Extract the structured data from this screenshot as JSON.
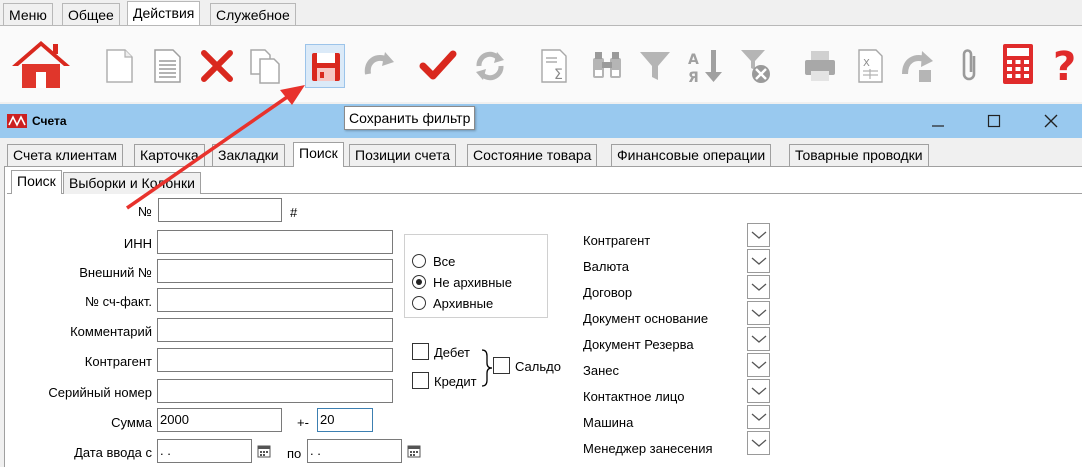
{
  "menu_tabs": [
    "Меню",
    "Общее",
    "Действия",
    "Служебное"
  ],
  "active_menu_tab": "Действия",
  "toolbar": {
    "buttons": [
      "home-icon",
      "new-document-icon",
      "document-icon",
      "delete-icon",
      "copy-icon",
      "save-filter-icon",
      "undo-icon",
      "confirm-icon",
      "refresh-icon",
      "sum-icon",
      "binoculars-icon",
      "filter-icon",
      "sort-icon",
      "clear-filter-icon",
      "print-icon",
      "excel-icon",
      "export-icon",
      "attach-icon",
      "calculator-icon",
      "help-icon"
    ],
    "tooltip": "Сохранить фильтр"
  },
  "window": {
    "title": "Счета"
  },
  "tabs": [
    "Счета клиентам",
    "Карточка",
    "Закладки",
    "Поиск",
    "Позиции счета",
    "Состояние товара",
    "Финансовые операции",
    "Товарные проводки"
  ],
  "active_tab": "Поиск",
  "subtabs": [
    "Поиск",
    "Выборки и Колонки"
  ],
  "form": {
    "number_label": "№",
    "number_value": "",
    "hash": "#",
    "inn_label": "ИНН",
    "inn_value": "",
    "ext_number_label": "Внешний №",
    "ext_number_value": "",
    "invoice_label": "№ сч-факт.",
    "invoice_value": "",
    "comment_label": "Комментарий",
    "comment_value": "",
    "counterparty_label": "Контрагент",
    "counterparty_value": "",
    "serial_label": "Серийный номер",
    "serial_value": "",
    "sum_label": "Сумма",
    "sum_value": "2000",
    "plusminus_label": "+-",
    "plusminus_value": "20",
    "date_from_label": "Дата ввода с",
    "date_from_value": " .  .",
    "date_to_label": "по",
    "date_to_value": " .  ."
  },
  "archive_options": [
    "Все",
    "Не архивные",
    "Архивные"
  ],
  "archive_selected": "Не архивные",
  "debit_label": "Дебет",
  "credit_label": "Кредит",
  "balance_label": "Сальдо",
  "filters": [
    "Контрагент",
    "Валюта",
    "Договор",
    "Документ основание",
    "Документ Резерва",
    "Занес",
    "Контактное лицо",
    "Машина",
    "Менеджер занесения"
  ],
  "colors": {
    "title_bar": "#99c9ef",
    "arrow": "#e8322c",
    "calc": "#e02b2b"
  }
}
